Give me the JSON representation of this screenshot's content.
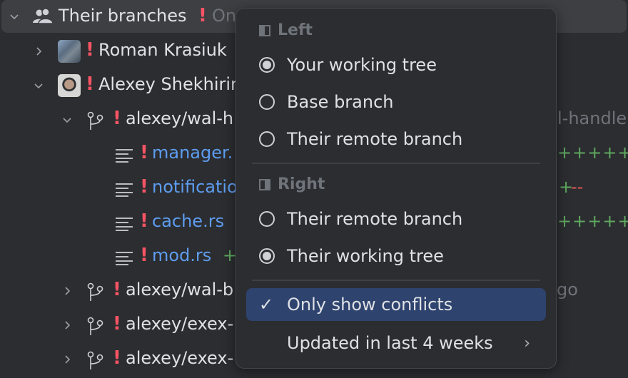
{
  "tree": {
    "header": {
      "label": "Their branches",
      "conflict_mark": "!",
      "filter_hint": "On",
      "expanded": true
    },
    "users": [
      {
        "name": "Roman Krasiuk",
        "conflict_mark": "!",
        "expanded": false
      },
      {
        "name": "Alexey Shekhirin",
        "display": "Alexey Shekhirin",
        "conflict_mark": "!",
        "expanded": true
      }
    ],
    "branches": [
      {
        "name": "alexey/wal-h",
        "conflict_mark": "!",
        "expanded": true,
        "trailing_hint": "l-handle",
        "files": [
          {
            "name": "manager.",
            "conflict_mark": "!",
            "diff_added": "+++++++",
            "diff_removed": ""
          },
          {
            "name": "notificatio",
            "conflict_mark": "!",
            "diff_added": "+",
            "diff_removed": "--"
          },
          {
            "name": "cache.rs",
            "conflict_mark": "!",
            "diff_added": "+++++++",
            "diff_removed": ""
          },
          {
            "name": "mod.rs",
            "conflict_mark": "!",
            "diff_added": "+",
            "diff_removed": ""
          }
        ]
      },
      {
        "name": "alexey/wal-b",
        "conflict_mark": "!",
        "expanded": false,
        "trailing_hint": "go"
      },
      {
        "name": "alexey/exex-",
        "conflict_mark": "!",
        "expanded": false,
        "trailing_hint": ""
      },
      {
        "name": "alexey/exex-",
        "conflict_mark": "!",
        "expanded": false,
        "trailing_hint": ""
      }
    ]
  },
  "popup": {
    "left_section": {
      "title": "Left",
      "options": [
        {
          "label": "Your working tree",
          "selected": true
        },
        {
          "label": "Base branch",
          "selected": false
        },
        {
          "label": "Their remote branch",
          "selected": false
        }
      ]
    },
    "right_section": {
      "title": "Right",
      "options": [
        {
          "label": "Their remote branch",
          "selected": false
        },
        {
          "label": "Their working tree",
          "selected": true
        }
      ]
    },
    "only_conflicts": {
      "label": "Only show conflicts",
      "checked": true,
      "check_glyph": "✓"
    },
    "updated": {
      "label": "Updated in last 4 weeks",
      "arrow": "›"
    }
  },
  "colors": {
    "background": "#2b2d30",
    "conflict": "#f75464",
    "file_link": "#5e9cf0",
    "diff_added": "#5fa85f",
    "diff_removed": "#e55757",
    "selection": "#2e436e"
  }
}
